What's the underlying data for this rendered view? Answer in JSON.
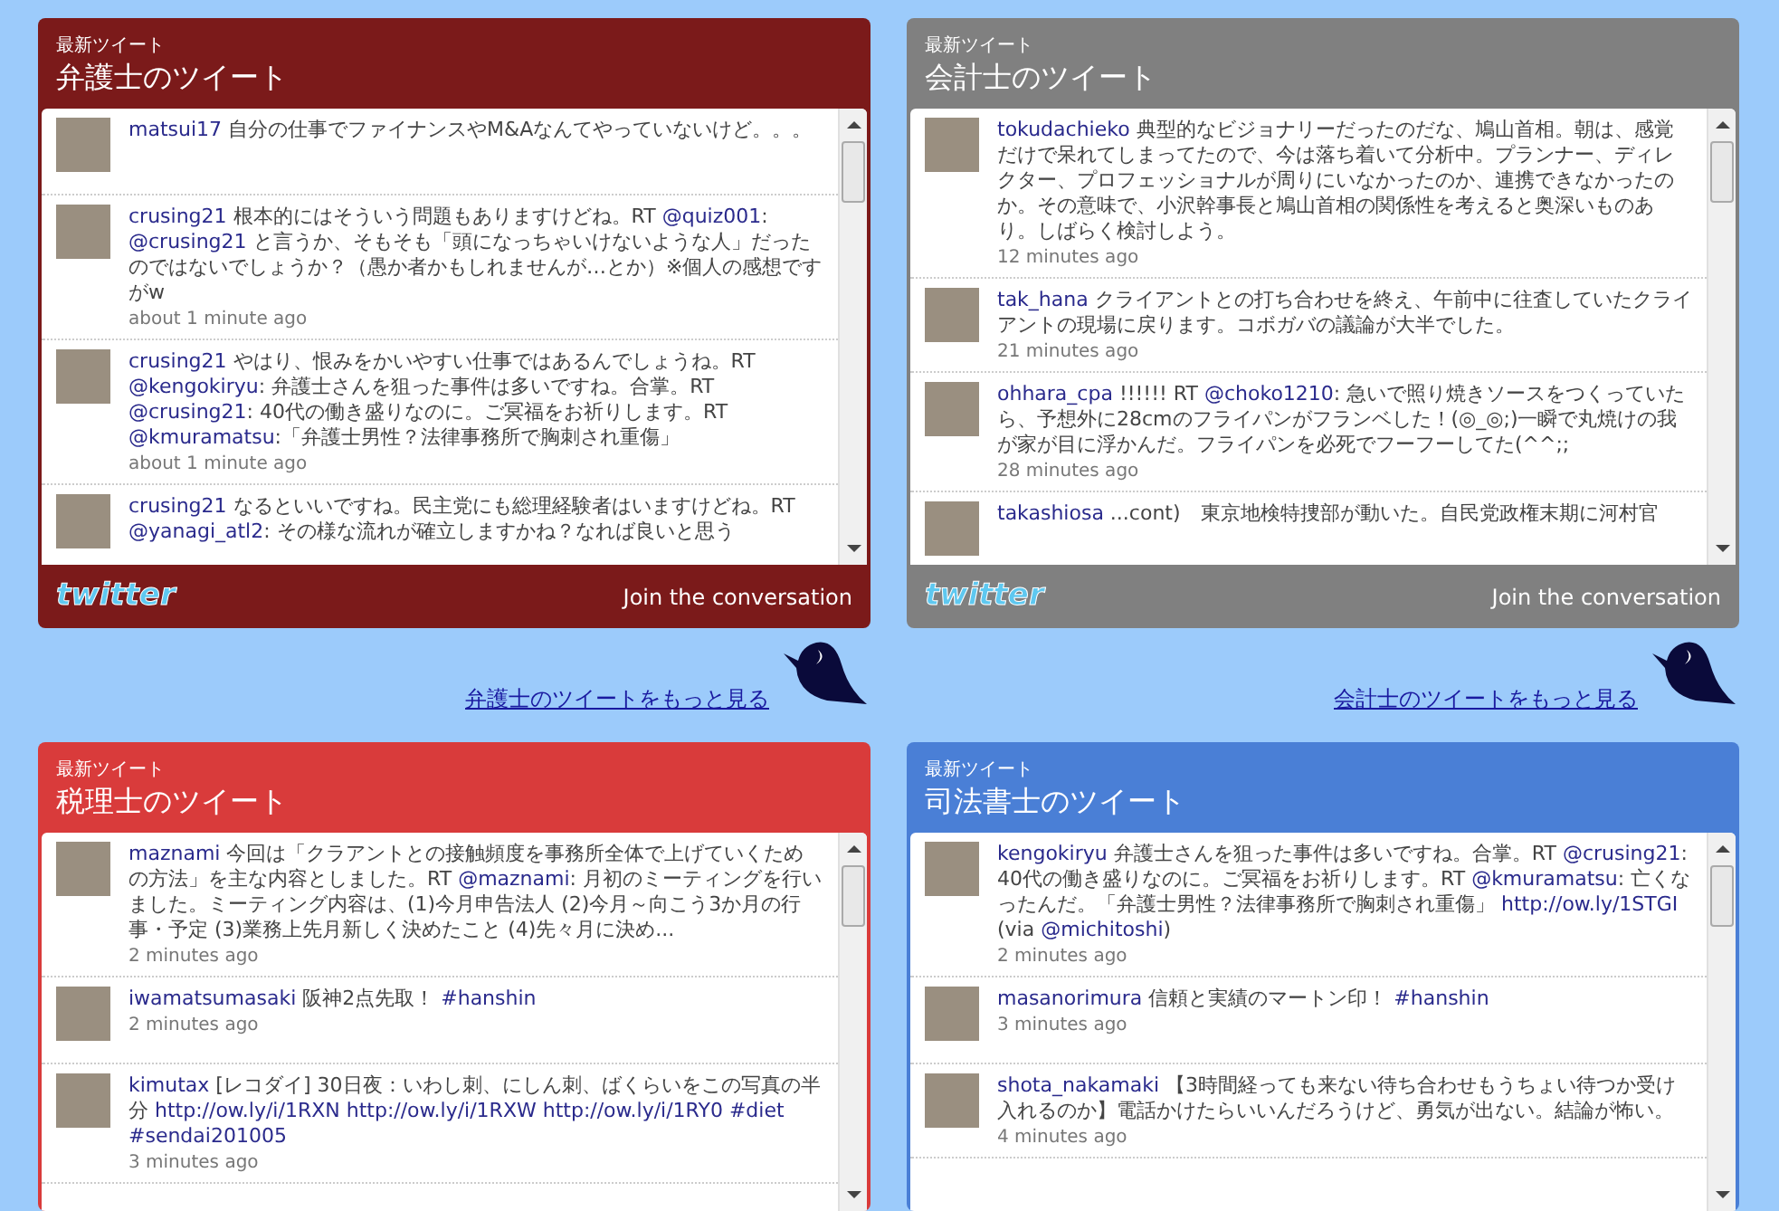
{
  "panels": [
    {
      "color": "#7b1a1a",
      "kicker": "最新ツイート",
      "title": "弁護士のツイート",
      "logo": "twitter",
      "footer_link": "Join the conversation",
      "more_link": "弁護士のツイートをもっと見る",
      "tweets": [
        {
          "user": "matsui17",
          "parts": [
            {
              "kind": "plain",
              "text": " 自分の仕事でファイナンスやM&Aなんてやっていないけど。。。"
            }
          ]
        },
        {
          "user": "crusing21",
          "parts": [
            {
              "kind": "plain",
              "text": " 根本的にはそういう問題もありますけどね。RT "
            },
            {
              "kind": "link",
              "text": "@quiz001"
            },
            {
              "kind": "plain",
              "text": ": "
            },
            {
              "kind": "link",
              "text": "@crusing21"
            },
            {
              "kind": "plain",
              "text": " と言うか、そもそも「頭になっちゃいけないような人」だったのではないでしょうか？（愚か者かもしれませんが…とか）※個人の感想ですがw"
            }
          ],
          "time": "about 1 minute ago"
        },
        {
          "user": "crusing21",
          "parts": [
            {
              "kind": "plain",
              "text": " やはり、恨みをかいやすい仕事ではあるんでしょうね。RT "
            },
            {
              "kind": "link",
              "text": "@kengokiryu"
            },
            {
              "kind": "plain",
              "text": ": 弁護士さんを狙った事件は多いですね。合掌。RT "
            },
            {
              "kind": "link",
              "text": "@crusing21"
            },
            {
              "kind": "plain",
              "text": ": 40代の働き盛りなのに。ご冥福をお祈りします。RT "
            },
            {
              "kind": "link",
              "text": "@kmuramatsu"
            },
            {
              "kind": "plain",
              "text": ":「弁護士男性？法律事務所で胸刺され重傷」"
            }
          ],
          "time": "about 1 minute ago"
        },
        {
          "user": "crusing21",
          "parts": [
            {
              "kind": "plain",
              "text": " なるといいですね。民主党にも総理経験者はいますけどね。RT "
            },
            {
              "kind": "link",
              "text": "@yanagi_atl2"
            },
            {
              "kind": "plain",
              "text": ": その様な流れが確立しますかね？なれば良いと思う"
            }
          ]
        }
      ]
    },
    {
      "color": "#808080",
      "kicker": "最新ツイート",
      "title": "会計士のツイート",
      "logo": "twitter",
      "footer_link": "Join the conversation",
      "more_link": "会計士のツイートをもっと見る",
      "tweets": [
        {
          "user": "tokudachieko",
          "parts": [
            {
              "kind": "plain",
              "text": " 典型的なビジョナリーだったのだな、鳩山首相。朝は、感覚だけで呆れてしまってたので、今は落ち着いて分析中。プランナー、ディレクター、プロフェッショナルが周りにいなかったのか、連携できなかったのか。その意味で、小沢幹事長と鳩山首相の関係性を考えると奥深いものあり。しばらく検討しよう。"
            }
          ],
          "time": "12 minutes ago"
        },
        {
          "user": "tak_hana",
          "parts": [
            {
              "kind": "plain",
              "text": " クライアントとの打ち合わせを終え、午前中に往査していたクライアントの現場に戻ります。コボガバの議論が大半でした。"
            }
          ],
          "time": "21 minutes ago"
        },
        {
          "user": "ohhara_cpa",
          "parts": [
            {
              "kind": "plain",
              "text": " !!!!!! RT "
            },
            {
              "kind": "link",
              "text": "@choko1210"
            },
            {
              "kind": "plain",
              "text": ": 急いで照り焼きソースをつくっていたら、予想外に28cmのフライパンがフランベした！(◎_◎;)一瞬で丸焼けの我が家が目に浮かんだ。フライパンを必死でフーフーしてた(^^;;"
            }
          ],
          "time": "28 minutes ago"
        },
        {
          "user": "takashiosa",
          "parts": [
            {
              "kind": "plain",
              "text": " ...cont)　東京地検特捜部が動いた。自民党政権末期に河村官"
            }
          ]
        }
      ]
    },
    {
      "color": "#d93b3b",
      "kicker": "最新ツイート",
      "title": "税理士のツイート",
      "tweets": [
        {
          "user": "maznami",
          "parts": [
            {
              "kind": "plain",
              "text": " 今回は「クラアントとの接触頻度を事務所全体で上げていくための方法」を主な内容としました。RT "
            },
            {
              "kind": "link",
              "text": "@maznami"
            },
            {
              "kind": "plain",
              "text": ": 月初のミーティングを行いました。ミーティング内容は、(1)今月申告法人 (2)今月～向こう3か月の行事・予定 (3)業務上先月新しく決めたこと (4)先々月に決め..."
            }
          ],
          "time": "2 minutes ago"
        },
        {
          "user": "iwamatsumasaki",
          "parts": [
            {
              "kind": "plain",
              "text": " 阪神2点先取！ "
            },
            {
              "kind": "link",
              "text": "#hanshin"
            }
          ],
          "time": "2 minutes ago"
        },
        {
          "user": "kimutax",
          "parts": [
            {
              "kind": "plain",
              "text": " [レコダイ] 30日夜：いわし刺、にしん刺、ばくらいをこの写真の半分 "
            },
            {
              "kind": "link",
              "text": "http://ow.ly/i/1RXN"
            },
            {
              "kind": "space"
            },
            {
              "kind": "link",
              "text": "http://ow.ly/i/1RXW"
            },
            {
              "kind": "space"
            },
            {
              "kind": "link",
              "text": "http://ow.ly/i/1RY0"
            },
            {
              "kind": "space"
            },
            {
              "kind": "link",
              "text": "#diet"
            },
            {
              "kind": "space"
            },
            {
              "kind": "link",
              "text": "#sendai201005"
            }
          ],
          "time": "3 minutes ago"
        }
      ]
    },
    {
      "color": "#4a7fd6",
      "kicker": "最新ツイート",
      "title": "司法書士のツイート",
      "tweets": [
        {
          "user": "kengokiryu",
          "parts": [
            {
              "kind": "plain",
              "text": " 弁護士さんを狙った事件は多いですね。合掌。RT "
            },
            {
              "kind": "link",
              "text": "@crusing21"
            },
            {
              "kind": "plain",
              "text": ": 40代の働き盛りなのに。ご冥福をお祈りします。RT "
            },
            {
              "kind": "link",
              "text": "@kmuramatsu"
            },
            {
              "kind": "plain",
              "text": ": 亡くなったんだ。「弁護士男性？法律事務所で胸刺され重傷」 "
            },
            {
              "kind": "link",
              "text": "http://ow.ly/1STGI"
            },
            {
              "kind": "plain",
              "text": " (via "
            },
            {
              "kind": "link",
              "text": "@michitoshi"
            },
            {
              "kind": "plain",
              "text": ")"
            }
          ],
          "time": "2 minutes ago"
        },
        {
          "user": "masanorimura",
          "parts": [
            {
              "kind": "plain",
              "text": " 信頼と実績のマートン印！ "
            },
            {
              "kind": "link",
              "text": "#hanshin"
            }
          ],
          "time": "3 minutes ago"
        },
        {
          "user": "shota_nakamaki",
          "parts": [
            {
              "kind": "plain",
              "text": " 【3時間経っても来ない待ち合わせもうちょい待つか受け入れるのか】電話かけたらいいんだろうけど、勇気が出ない。結論が怖い。"
            }
          ],
          "time": "4 minutes ago"
        }
      ]
    }
  ]
}
